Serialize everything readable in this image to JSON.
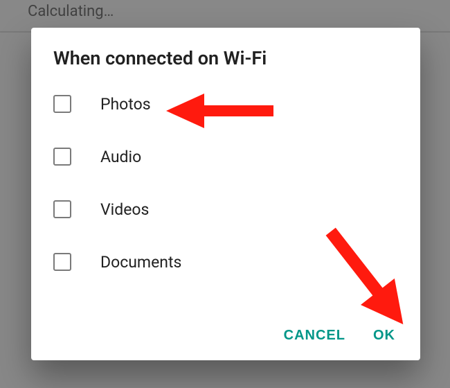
{
  "background": {
    "status_text": "Calculating…"
  },
  "dialog": {
    "title": "When connected on Wi-Fi",
    "options": [
      {
        "label": "Photos",
        "checked": false
      },
      {
        "label": "Audio",
        "checked": false
      },
      {
        "label": "Videos",
        "checked": false
      },
      {
        "label": "Documents",
        "checked": false
      }
    ],
    "actions": {
      "cancel": "CANCEL",
      "ok": "OK"
    }
  },
  "annotations": {
    "arrow1_target": "photos-option",
    "arrow2_target": "ok-button",
    "color": "#ff1a0e"
  }
}
